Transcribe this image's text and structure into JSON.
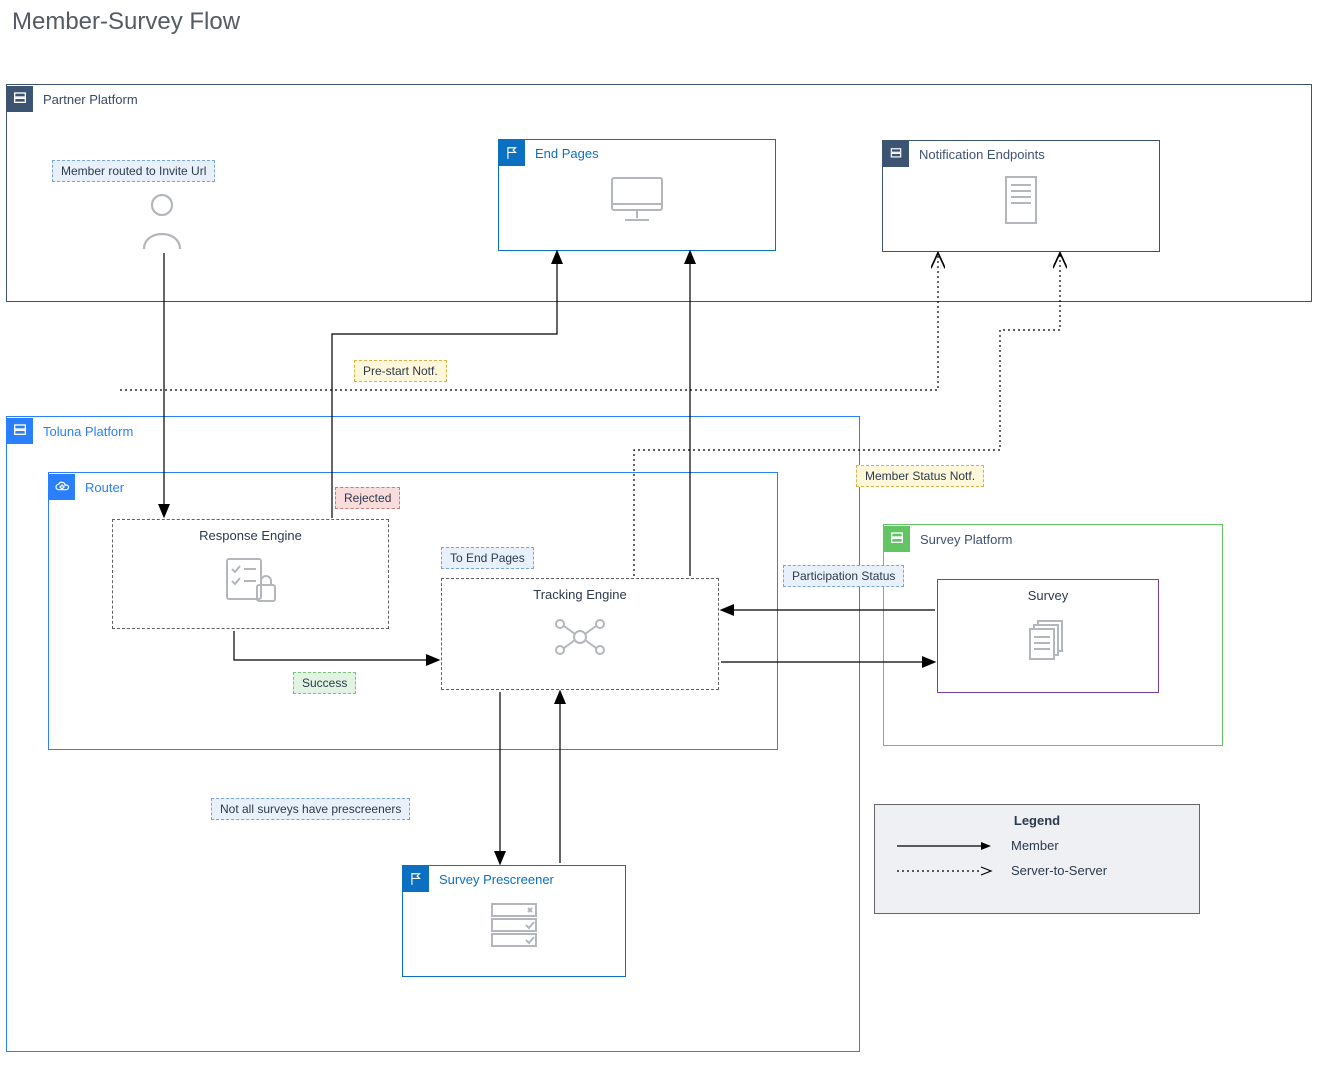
{
  "title": "Member-Survey Flow",
  "partner": {
    "label": "Partner Platform",
    "memberRouted": "Member routed to Invite Url",
    "endPages": "End Pages",
    "notificationEndpoints": "Notification Endpoints"
  },
  "toluna": {
    "label": "Toluna Platform",
    "router": "Router",
    "responseEngine": "Response Engine",
    "trackingEngine": "Tracking Engine",
    "surveyPrescreener": "Survey Prescreener"
  },
  "surveyPlatform": {
    "label": "Survey Platform",
    "survey": "Survey"
  },
  "tags": {
    "preStart": "Pre-start Notf.",
    "rejected": "Rejected",
    "toEndPages": "To End Pages",
    "participationStatus": "Participation Status",
    "memberStatus": "Member Status Notf.",
    "success": "Success",
    "note": "Not all surveys have prescreeners"
  },
  "legend": {
    "title": "Legend",
    "member": "Member",
    "s2s": "Server-to-Server"
  },
  "colors": {
    "partnerBorder": "#3d5372",
    "partnerIconBg": "#3d5372",
    "tolunaBorder": "#2a7fff",
    "tolunaIconBg": "#2a7fff",
    "surveyPlatformBorder": "#62c462",
    "surveyPlatformIconBg": "#62c462",
    "surveyBorder": "#7a3e9d",
    "endPagesBorder": "#0b6fc2",
    "prescreenerBorder": "#0b6fc2"
  }
}
